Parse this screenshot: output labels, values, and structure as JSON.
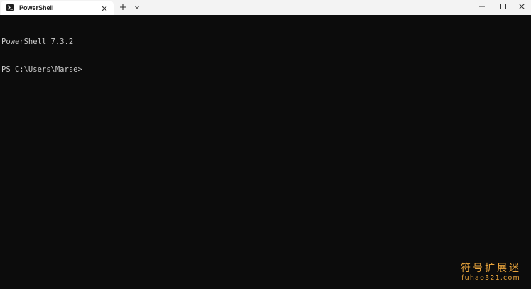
{
  "tab": {
    "icon": "powershell-prompt-icon",
    "title": "PowerShell",
    "close_icon": "close-icon"
  },
  "toolbar": {
    "new_tab_icon": "plus-icon",
    "dropdown_icon": "chevron-down-icon"
  },
  "window_controls": {
    "minimize_icon": "minimize-icon",
    "maximize_icon": "maximize-icon",
    "close_icon": "close-icon"
  },
  "terminal": {
    "lines": [
      "PowerShell 7.3.2",
      "PS C:\\Users\\Marse>"
    ],
    "foreground": "#cccccc",
    "background": "#0c0c0c"
  },
  "watermark": {
    "chinese": "符号扩展迷",
    "url": "fuhao321.com",
    "color": "#e8a43c"
  }
}
